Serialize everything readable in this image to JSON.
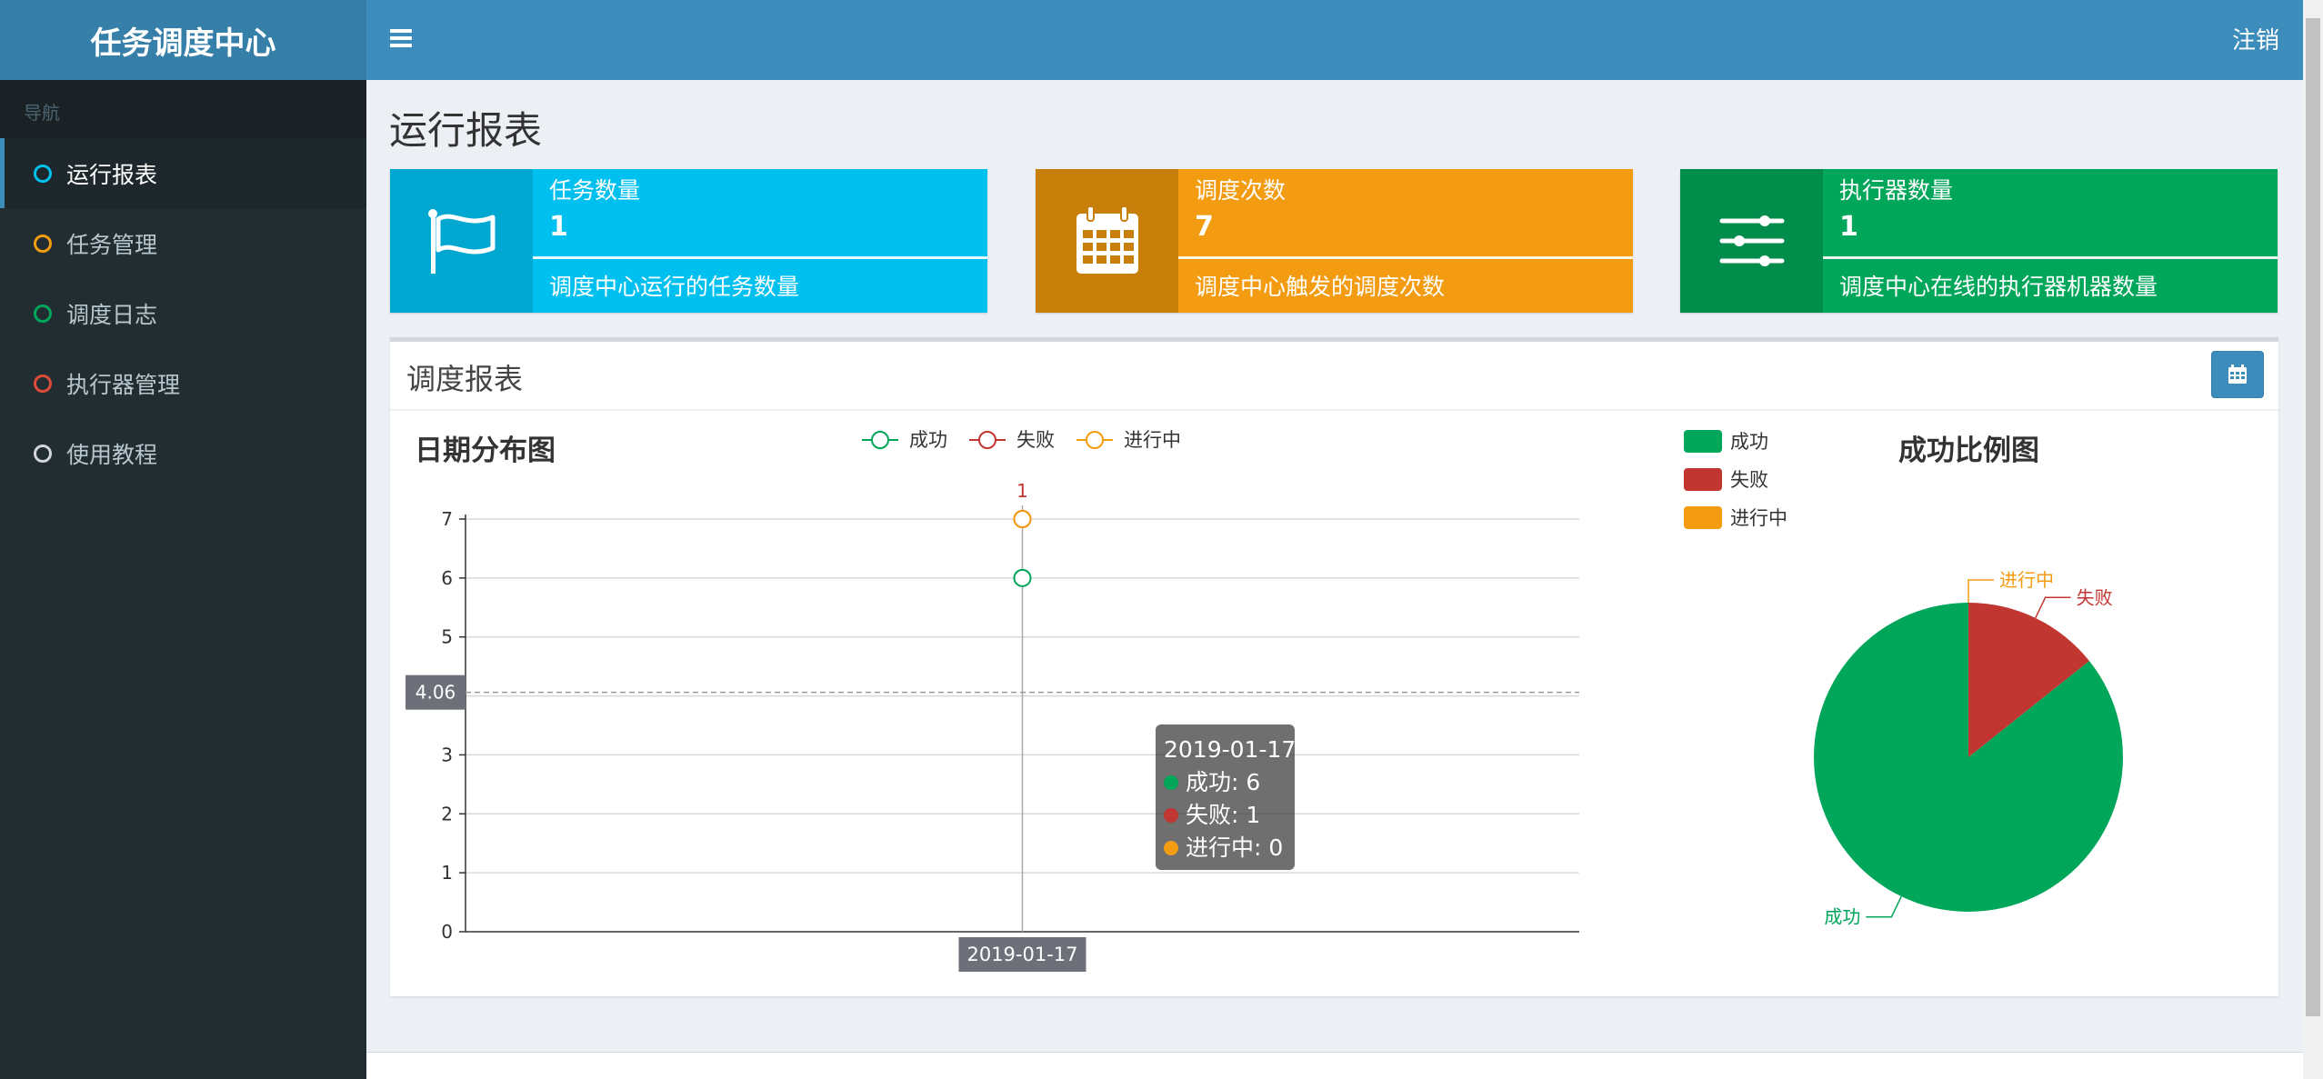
{
  "header": {
    "logo": "任务调度中心",
    "logout": "注销"
  },
  "sidebar": {
    "header": "导航",
    "items": [
      {
        "label": "运行报表",
        "color": "#00c0ef",
        "active": true
      },
      {
        "label": "任务管理",
        "color": "#f39c12"
      },
      {
        "label": "调度日志",
        "color": "#00a65a"
      },
      {
        "label": "执行器管理",
        "color": "#dd4b39"
      },
      {
        "label": "使用教程",
        "color": "#d2d6de"
      }
    ]
  },
  "page": {
    "title": "运行报表"
  },
  "info_boxes": [
    {
      "label": "任务数量",
      "value": "1",
      "desc": "调度中心运行的任务数量",
      "icon": "flag-icon",
      "color": "#00c0ef"
    },
    {
      "label": "调度次数",
      "value": "7",
      "desc": "调度中心触发的调度次数",
      "icon": "calendar-icon",
      "color": "#f39c12"
    },
    {
      "label": "执行器数量",
      "value": "1",
      "desc": "调度中心在线的执行器机器数量",
      "icon": "sliders-icon",
      "color": "#00a65a"
    }
  ],
  "report": {
    "title": "调度报表"
  },
  "chart_data": [
    {
      "type": "line",
      "title": "日期分布图",
      "categories": [
        "2019-01-17"
      ],
      "series": [
        {
          "name": "成功",
          "values": [
            6
          ],
          "color": "#00a65a"
        },
        {
          "name": "失败",
          "values": [
            1
          ],
          "color": "#c23632"
        },
        {
          "name": "进行中",
          "values": [
            0
          ],
          "color": "#f39c12"
        }
      ],
      "stacked": true,
      "ylim": [
        0,
        7
      ],
      "yticks": [
        "0",
        "1",
        "2",
        "3",
        "4",
        "5",
        "6",
        "7"
      ],
      "point_label": "1",
      "axis_pointer_y": "4.06",
      "axis_pointer_x": "2019-01-17",
      "legend": "top-center",
      "grid": true,
      "tooltip": {
        "title": "2019-01-17",
        "rows": [
          "成功: 6",
          "失败: 1",
          "进行中: 0"
        ]
      }
    },
    {
      "type": "pie",
      "title": "成功比例图",
      "slices": [
        {
          "name": "成功",
          "value": 6,
          "color": "#00a65a"
        },
        {
          "name": "失败",
          "value": 1,
          "color": "#c23632"
        },
        {
          "name": "进行中",
          "value": 0,
          "color": "#f39c12"
        }
      ],
      "legend": "top-left"
    }
  ]
}
